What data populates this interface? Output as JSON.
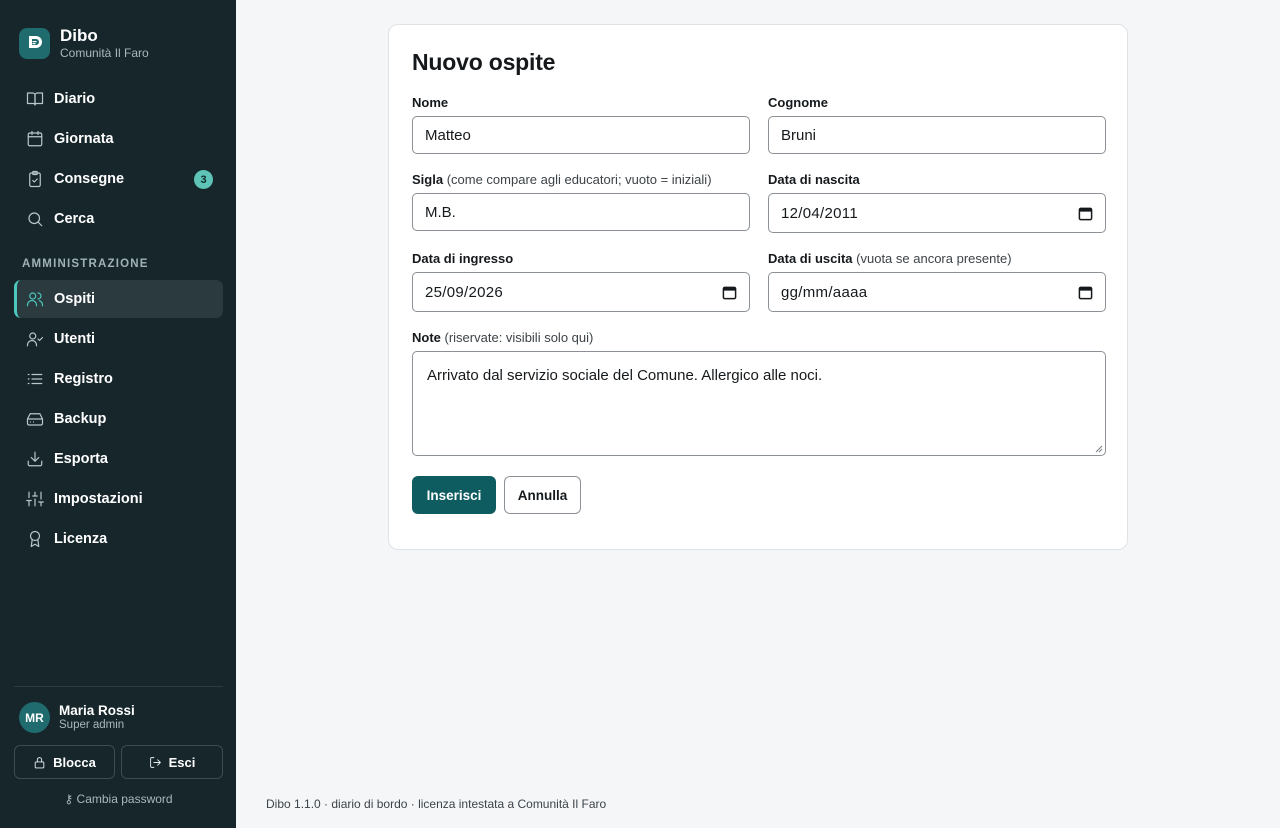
{
  "brand": {
    "name": "Dibo",
    "subtitle": "Comunità Il Faro"
  },
  "nav": {
    "items": [
      {
        "label": "Diario",
        "icon": "book-icon"
      },
      {
        "label": "Giornata",
        "icon": "calendar-icon"
      },
      {
        "label": "Consegne",
        "icon": "clipboard-check-icon",
        "badge": "3"
      },
      {
        "label": "Cerca",
        "icon": "search-icon"
      }
    ],
    "section_title": "AMMINISTRAZIONE",
    "admin_items": [
      {
        "label": "Ospiti",
        "icon": "users-icon",
        "active": true
      },
      {
        "label": "Utenti",
        "icon": "user-check-icon"
      },
      {
        "label": "Registro",
        "icon": "list-icon"
      },
      {
        "label": "Backup",
        "icon": "hard-drive-icon"
      },
      {
        "label": "Esporta",
        "icon": "download-icon"
      },
      {
        "label": "Impostazioni",
        "icon": "sliders-icon"
      },
      {
        "label": "Licenza",
        "icon": "award-icon"
      }
    ]
  },
  "user": {
    "initials": "MR",
    "name": "Maria Rossi",
    "role": "Super admin"
  },
  "sidebar_actions": {
    "lock": "Blocca",
    "exit": "Esci",
    "change_password": "Cambia password"
  },
  "form": {
    "title": "Nuovo ospite",
    "nome": {
      "label": "Nome",
      "value": "Matteo"
    },
    "cognome": {
      "label": "Cognome",
      "value": "Bruni"
    },
    "sigla": {
      "label": "Sigla",
      "hint": "(come compare agli educatori; vuoto = iniziali)",
      "value": "M.B."
    },
    "data_nascita": {
      "label": "Data di nascita",
      "value": "12/04/2011"
    },
    "data_ingresso": {
      "label": "Data di ingresso",
      "value": "25/09/2026"
    },
    "data_uscita": {
      "label": "Data di uscita",
      "hint": "(vuota se ancora presente)",
      "placeholder": "gg/mm/aaaa"
    },
    "note": {
      "label": "Note",
      "hint": "(riservate: visibili solo qui)",
      "value": "Arrivato dal servizio sociale del Comune. Allergico alle noci."
    },
    "submit_label": "Inserisci",
    "cancel_label": "Annulla"
  },
  "footer": "Dibo 1.1.0 · diario di bordo · licenza intestata a Comunità Il Faro",
  "colors": {
    "sidebar_bg": "#16262b",
    "accent": "#4cc8bc",
    "primary_button": "#0f5c60"
  }
}
